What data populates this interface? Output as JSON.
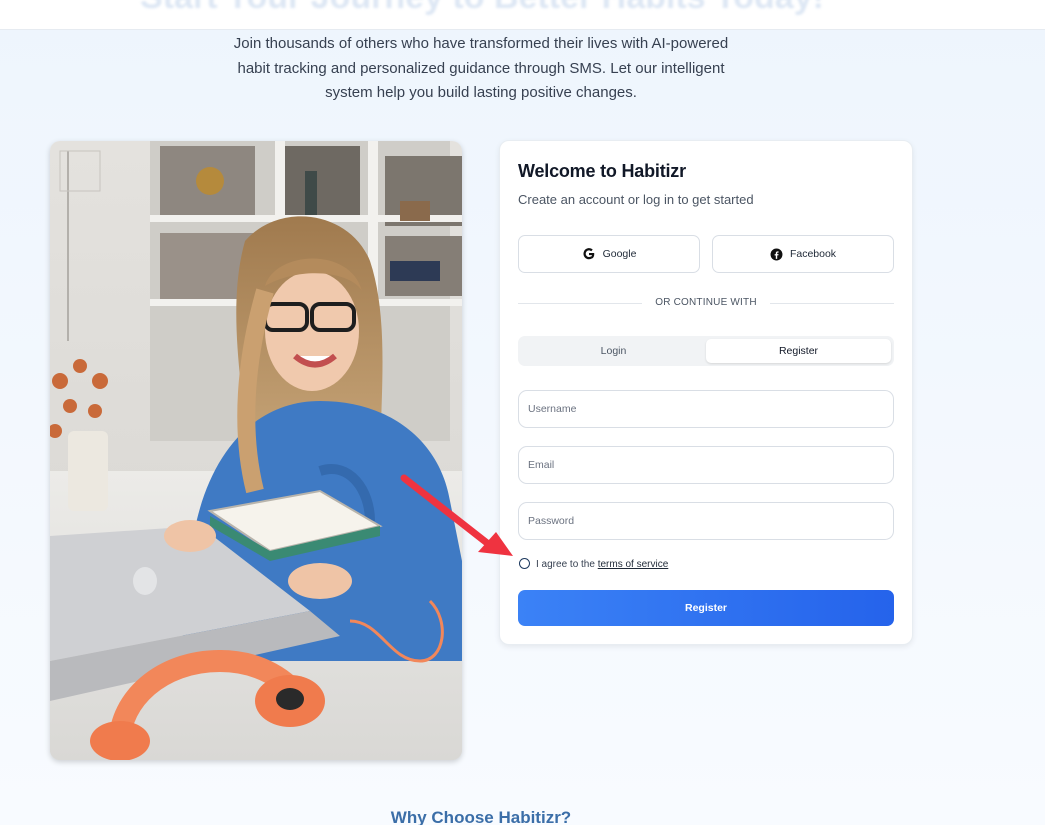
{
  "hero": {
    "title": "Start Your Journey to Better Habits Today!",
    "intro": "Join thousands of others who have transformed their lives with AI-powered habit tracking and personalized guidance through SMS. Let our intelligent system help you build lasting positive changes."
  },
  "auth_card": {
    "title": "Welcome to Habitizr",
    "subtitle": "Create an account or log in to get started",
    "google_label": "Google",
    "facebook_label": "Facebook",
    "divider_text": "OR CONTINUE WITH",
    "tabs": [
      {
        "label": "Login",
        "active": false
      },
      {
        "label": "Register",
        "active": true
      }
    ],
    "username_placeholder": "Username",
    "email_placeholder": "Email",
    "password_placeholder": "Password",
    "terms_prefix": "I agree to the",
    "terms_link": "terms of service",
    "terms_checked": false,
    "submit_label": "Register"
  },
  "section_heading": "Why Choose Habitizr?",
  "colors": {
    "accent": "#3b82f6",
    "accent_dark": "#2563eb",
    "page_bg": "#eef5fd",
    "annotation_arrow": "#ef3340"
  },
  "icons": [
    "google-icon",
    "facebook-icon",
    "annotation-arrow"
  ]
}
